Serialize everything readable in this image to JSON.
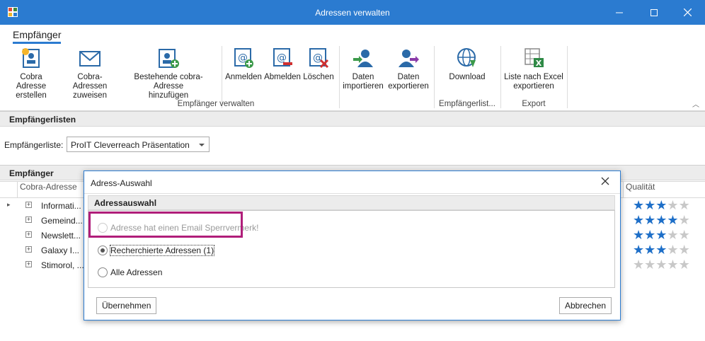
{
  "window": {
    "title": "Adressen verwalten"
  },
  "ribbon": {
    "tab": "Empfänger",
    "buttons": [
      {
        "label1": "Cobra Adresse",
        "label2": "erstellen"
      },
      {
        "label1": "Cobra-Adressen",
        "label2": "zuweisen"
      },
      {
        "label1": "Bestehende cobra-Adresse",
        "label2": "hinzufügen"
      },
      {
        "label1": "Anmelden"
      },
      {
        "label1": "Abmelden"
      },
      {
        "label1": "Löschen"
      },
      {
        "label1": "Daten",
        "label2": "importieren"
      },
      {
        "label1": "Daten",
        "label2": "exportieren"
      },
      {
        "label1": "Download"
      },
      {
        "label1": "Liste nach Excel",
        "label2": "exportieren"
      }
    ],
    "groups": [
      "Empfänger verwalten",
      "Empfängerlist...",
      "Export"
    ]
  },
  "lists_section": {
    "header": "Empfängerlisten",
    "field_label": "Empfängerliste:",
    "selected": "ProIT Cleverreach Präsentation"
  },
  "recipients_section": {
    "header": "Empfänger",
    "columns": [
      "Cobra-Adresse",
      "Qualität"
    ],
    "rows": [
      {
        "label": "Informati...",
        "rating": 3
      },
      {
        "label": "Gemeind...",
        "rating": 4
      },
      {
        "label": "Newslett...",
        "rating": 3
      },
      {
        "label": "Galaxy I...",
        "rating": 3
      },
      {
        "label": "Stimorol, ...",
        "rating": 0
      }
    ],
    "max_rating": 5
  },
  "dialog": {
    "title": "Adress-Auswahl",
    "section": "Adressauswahl",
    "options": [
      {
        "label": "Adresse hat einen Email Sperrvermerk!",
        "state": "disabled"
      },
      {
        "label": "Recherchierte Adressen (1)",
        "state": "checked"
      },
      {
        "label": "Alle Adressen",
        "state": "unchecked"
      }
    ],
    "ok": "Übernehmen",
    "cancel": "Abbrechen"
  },
  "colors": {
    "accent": "#2b7bd0",
    "highlight": "#b01e7a",
    "star": "#1e6fc8"
  }
}
